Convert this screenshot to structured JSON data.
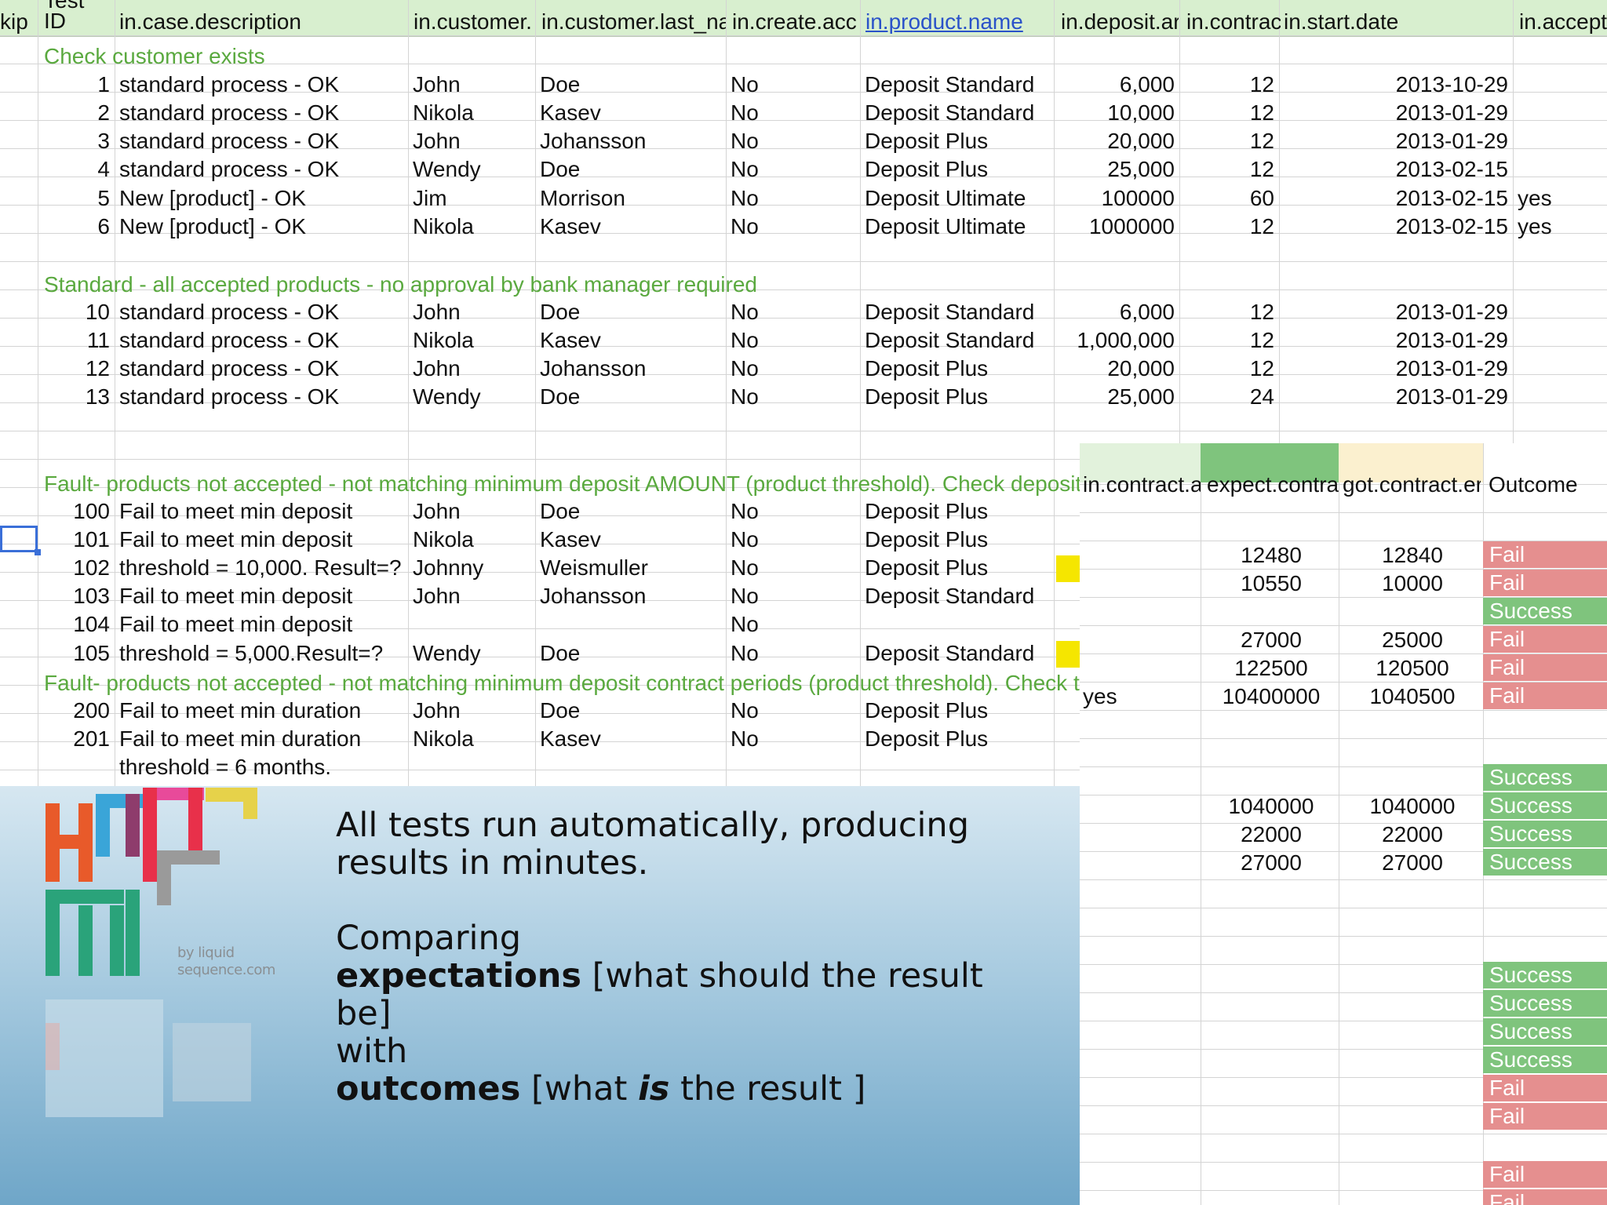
{
  "headers": [
    "kip",
    "Test ID",
    "in.case.description",
    "in.customer.",
    "in.customer.last_na",
    "in.create.acc",
    "in.product.name",
    "in.deposit.ar",
    "in.contrac",
    "in.start.date",
    "in.accept"
  ],
  "sections": [
    "Check customer exists",
    "Standard - all accepted products - no approval by bank manager required",
    "Fault- products not accepted - not matching minimum deposit AMOUNT (product threshold). Check deposit",
    "Fault- products not accepted - not matching minimum deposit contract periods (product threshold). Check t"
  ],
  "rows": [
    {
      "id": "1",
      "desc": "standard process - OK",
      "first": "John",
      "last": "Doe",
      "create": "No",
      "product": "Deposit Standard",
      "deposit": "6,000",
      "contract": "12",
      "start": "2013-10-29",
      "accept": ""
    },
    {
      "id": "2",
      "desc": "standard process - OK",
      "first": "Nikola",
      "last": "Kasev",
      "create": "No",
      "product": "Deposit Standard",
      "deposit": "10,000",
      "contract": "12",
      "start": "2013-01-29",
      "accept": ""
    },
    {
      "id": "3",
      "desc": "standard process - OK",
      "first": "John",
      "last": "Johansson",
      "create": "No",
      "product": "Deposit Plus",
      "deposit": "20,000",
      "contract": "12",
      "start": "2013-01-29",
      "accept": ""
    },
    {
      "id": "4",
      "desc": "standard process - OK",
      "first": "Wendy",
      "last": "Doe",
      "create": "No",
      "product": "Deposit Plus",
      "deposit": "25,000",
      "contract": "12",
      "start": "2013-02-15",
      "accept": ""
    },
    {
      "id": "5",
      "desc": "New [product] - OK",
      "first": "Jim",
      "last": "Morrison",
      "create": "No",
      "product": "Deposit Ultimate",
      "deposit": "100000",
      "contract": "60",
      "start": "2013-02-15",
      "accept": "yes"
    },
    {
      "id": "6",
      "desc": "New [product] - OK",
      "first": "Nikola",
      "last": "Kasev",
      "create": "No",
      "product": "Deposit Ultimate",
      "deposit": "1000000",
      "contract": "12",
      "start": "2013-02-15",
      "accept": "yes"
    },
    {
      "id": "10",
      "desc": "standard process - OK",
      "first": "John",
      "last": "Doe",
      "create": "No",
      "product": "Deposit Standard",
      "deposit": "6,000",
      "contract": "12",
      "start": "2013-01-29",
      "accept": ""
    },
    {
      "id": "11",
      "desc": "standard process - OK",
      "first": "Nikola",
      "last": "Kasev",
      "create": "No",
      "product": "Deposit Standard",
      "deposit": "1,000,000",
      "contract": "12",
      "start": "2013-01-29",
      "accept": ""
    },
    {
      "id": "12",
      "desc": "standard process - OK",
      "first": "John",
      "last": "Johansson",
      "create": "No",
      "product": "Deposit Plus",
      "deposit": "20,000",
      "contract": "12",
      "start": "2013-01-29",
      "accept": ""
    },
    {
      "id": "13",
      "desc": "standard process - OK",
      "first": "Wendy",
      "last": "Doe",
      "create": "No",
      "product": "Deposit Plus",
      "deposit": "25,000",
      "contract": "24",
      "start": "2013-01-29",
      "accept": ""
    },
    {
      "id": "100",
      "desc": "Fail to meet min deposit",
      "first": "John",
      "last": "Doe",
      "create": "No",
      "product": "Deposit Plus"
    },
    {
      "id": "101",
      "desc": "Fail to meet min deposit",
      "first": "Nikola",
      "last": "Kasev",
      "create": "No",
      "product": "Deposit Plus"
    },
    {
      "id": "102",
      "desc": "threshold = 10,000. Result=?",
      "first": "Johnny",
      "last": "Weismuller",
      "create": "No",
      "product": "Deposit Plus"
    },
    {
      "id": "103",
      "desc": "Fail to meet min deposit",
      "first": "John",
      "last": "Johansson",
      "create": "No",
      "product": "Deposit Standard"
    },
    {
      "id": "104",
      "desc": "Fail to meet min deposit",
      "first": "",
      "last": "",
      "create": "No",
      "product": ""
    },
    {
      "id": "105",
      "desc": "threshold = 5,000.Result=?",
      "first": "Wendy",
      "last": "Doe",
      "create": "No",
      "product": "Deposit Standard"
    },
    {
      "id": "200",
      "desc": "Fail to meet min duration",
      "first": "John",
      "last": "Doe",
      "create": "No",
      "product": "Deposit Plus"
    },
    {
      "id": "201",
      "desc": "Fail to meet min duration",
      "first": "Nikola",
      "last": "Kasev",
      "create": "No",
      "product": "Deposit Plus"
    },
    {
      "id": "",
      "desc": "threshold = 6 months.",
      "first": "",
      "last": "",
      "create": "",
      "product": ""
    }
  ],
  "right_headers": [
    "in.contract.a",
    "expect.contra",
    "got.contract.er",
    "Outcome"
  ],
  "right_rows": [
    {
      "accept": "",
      "expect": "12480",
      "got": "12840",
      "outcome": "Fail"
    },
    {
      "accept": "",
      "expect": "10550",
      "got": "10000",
      "outcome": "Fail"
    },
    {
      "accept": "",
      "expect": "",
      "got": "",
      "outcome": "Success"
    },
    {
      "accept": "",
      "expect": "27000",
      "got": "25000",
      "outcome": "Fail"
    },
    {
      "accept": "",
      "expect": "122500",
      "got": "120500",
      "outcome": "Fail"
    },
    {
      "accept": "yes",
      "expect": "10400000",
      "got": "1040500",
      "outcome": "Fail"
    },
    {
      "accept": "",
      "expect": "",
      "got": "",
      "outcome": "Success"
    },
    {
      "accept": "",
      "expect": "1040000",
      "got": "1040000",
      "outcome": "Success"
    },
    {
      "accept": "",
      "expect": "22000",
      "got": "22000",
      "outcome": "Success"
    },
    {
      "accept": "",
      "expect": "27000",
      "got": "27000",
      "outcome": "Success"
    },
    {
      "accept": "",
      "expect": "",
      "got": "",
      "outcome": "Success"
    },
    {
      "accept": "",
      "expect": "",
      "got": "",
      "outcome": "Success"
    },
    {
      "accept": "",
      "expect": "",
      "got": "",
      "outcome": "Success"
    },
    {
      "accept": "",
      "expect": "",
      "got": "",
      "outcome": "Success"
    },
    {
      "accept": "",
      "expect": "",
      "got": "",
      "outcome": "Fail"
    },
    {
      "accept": "",
      "expect": "",
      "got": "",
      "outcome": "Fail"
    },
    {
      "accept": "",
      "expect": "",
      "got": "",
      "outcome": "Fail"
    },
    {
      "accept": "",
      "expect": "",
      "got": "",
      "outcome": "Fail"
    }
  ],
  "banner": {
    "logo_sub_line1": "by liquid",
    "logo_sub_line2": "sequence.com",
    "line1": "All tests run automatically,  producing",
    "line2": "results in minutes.",
    "line3": "Comparing",
    "line4_bold": "expectations",
    "line4_rest": " [what should the result be]",
    "line5": "with",
    "line6_bold": "outcomes",
    "line6_mid": " [what ",
    "line6_ital": "is",
    "line6_end": " the result ]"
  },
  "colors": {
    "header_bg": "#d8efcf",
    "section_text": "#5aa93f",
    "fail_bg": "#e58f8f",
    "success_bg": "#7fc47d",
    "expect_header_bg": "#7fc47d",
    "got_header_bg": "#fbf0cf",
    "highlight_yellow": "#f5e600"
  }
}
